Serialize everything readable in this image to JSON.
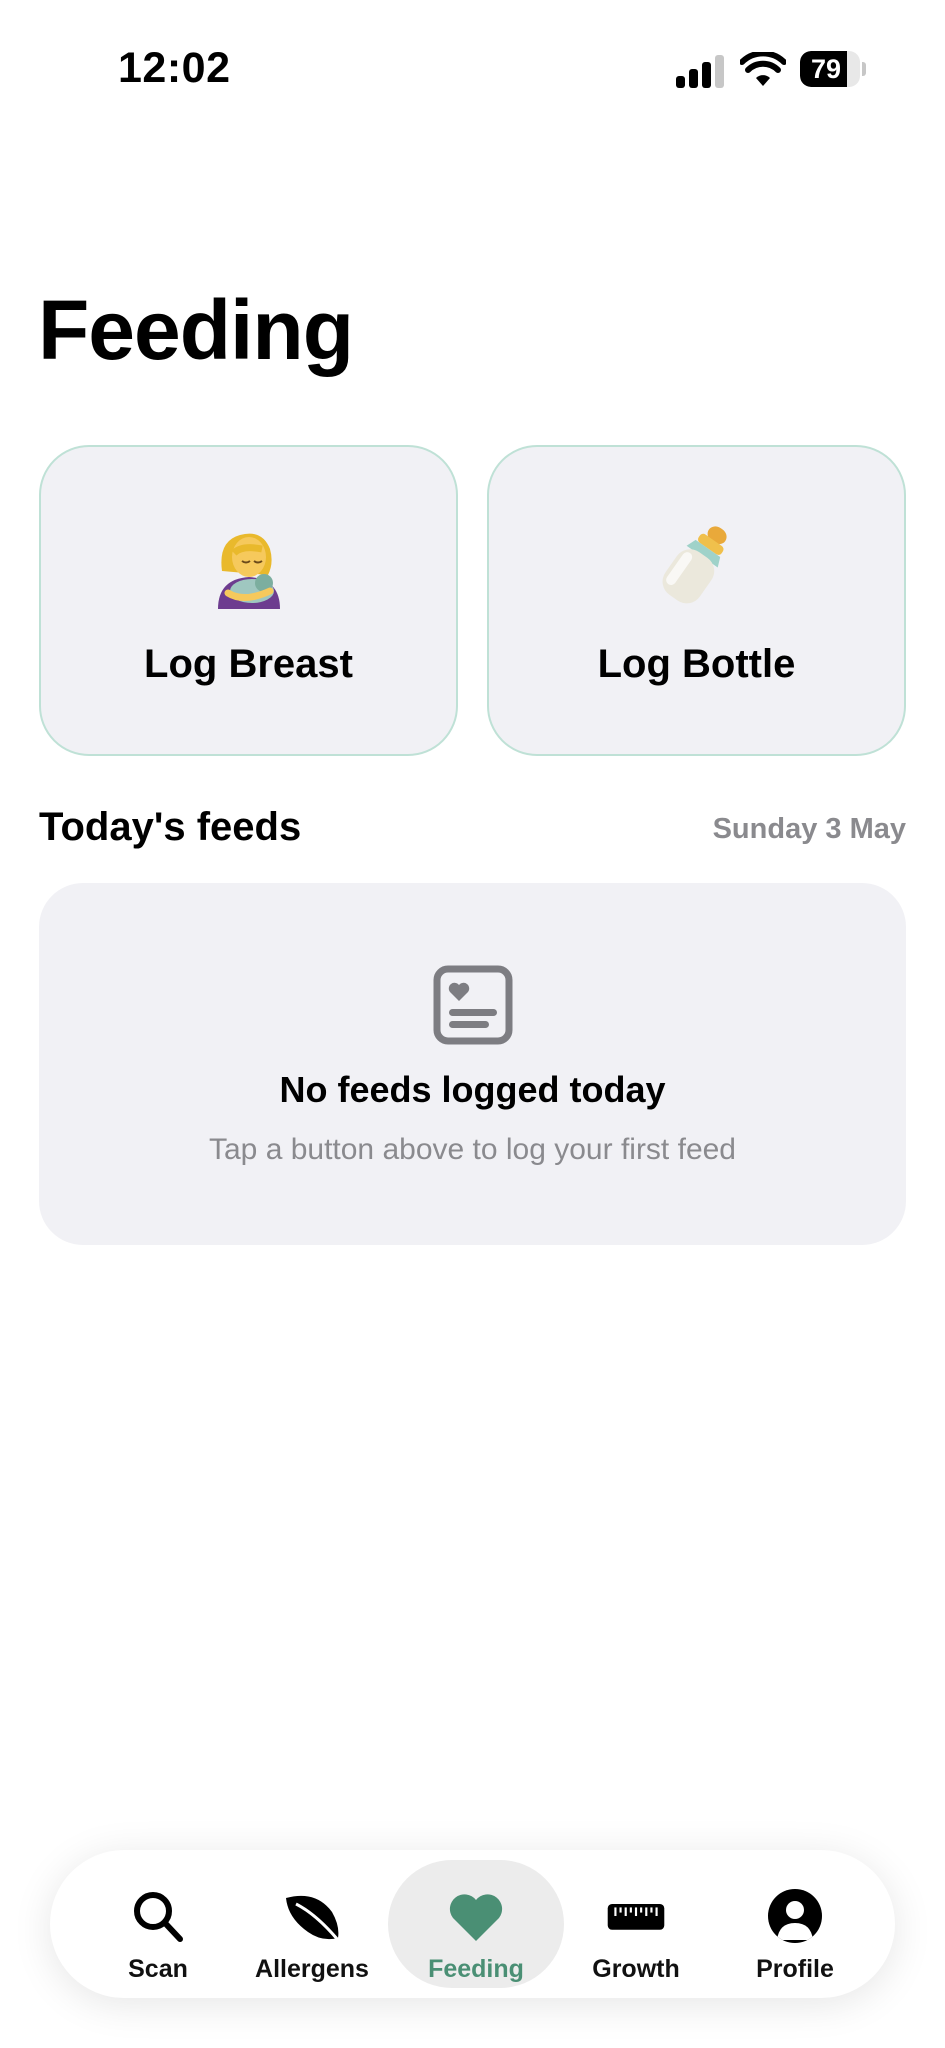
{
  "status_bar": {
    "time": "12:02",
    "battery_percent": "79",
    "battery_level": 0.79,
    "icons": [
      "cellular-signal-icon",
      "wifi-icon",
      "battery-icon"
    ]
  },
  "page": {
    "title": "Feeding"
  },
  "actions": [
    {
      "label": "Log Breast",
      "icon": "breastfeeding-emoji-icon"
    },
    {
      "label": "Log Bottle",
      "icon": "baby-bottle-emoji-icon"
    }
  ],
  "todays_feeds": {
    "title": "Today's feeds",
    "date": "Sunday 3 May",
    "empty_state": {
      "icon": "feed-log-icon",
      "title": "No feeds logged today",
      "subtitle": "Tap a button above to log your first feed"
    }
  },
  "tab_bar": {
    "active": "Feeding",
    "tabs": [
      {
        "label": "Scan",
        "icon": "search-icon"
      },
      {
        "label": "Allergens",
        "icon": "leaf-icon"
      },
      {
        "label": "Feeding",
        "icon": "heart-icon"
      },
      {
        "label": "Growth",
        "icon": "ruler-icon"
      },
      {
        "label": "Profile",
        "icon": "profile-icon"
      }
    ]
  },
  "colors": {
    "accent": "#4a8f74",
    "card_background": "#f1f1f5",
    "card_border": "#bfe1d6",
    "secondary_text": "#8a8a8e"
  }
}
